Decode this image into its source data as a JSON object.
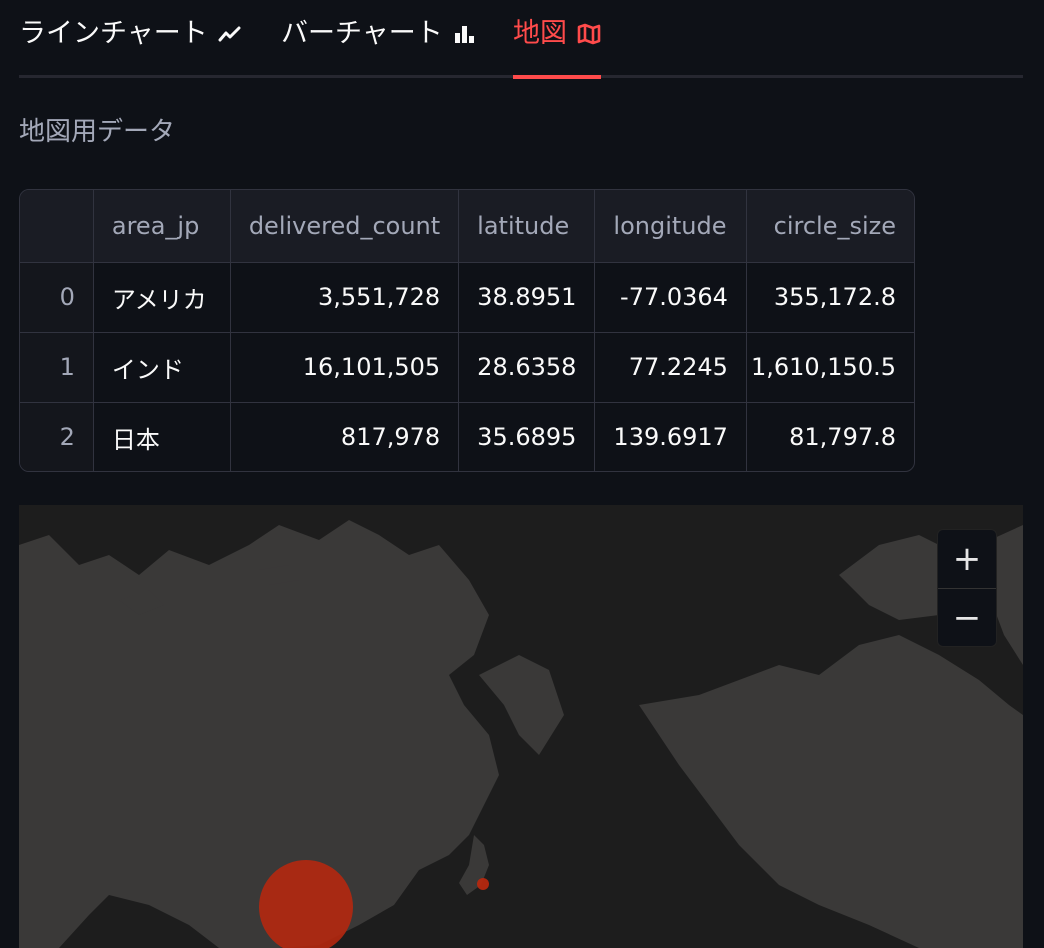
{
  "tabs": [
    {
      "label": "ラインチャート",
      "icon": "line-chart-icon",
      "active": false
    },
    {
      "label": "バーチャート",
      "icon": "bar-chart-icon",
      "active": false
    },
    {
      "label": "地図",
      "icon": "map-icon",
      "active": true
    }
  ],
  "subheading": "地図用データ",
  "table": {
    "columns": [
      "",
      "area_jp",
      "delivered_count",
      "latitude",
      "longitude",
      "circle_size"
    ],
    "rows": [
      {
        "index": "0",
        "area_jp": "アメリカ",
        "delivered_count": "3,551,728",
        "latitude": "38.8951",
        "longitude": "-77.0364",
        "circle_size": "355,172.8"
      },
      {
        "index": "1",
        "area_jp": "インド",
        "delivered_count": "16,101,505",
        "latitude": "28.6358",
        "longitude": "77.2245",
        "circle_size": "1,610,150.5"
      },
      {
        "index": "2",
        "area_jp": "日本",
        "delivered_count": "817,978",
        "latitude": "35.6895",
        "longitude": "139.6917",
        "circle_size": "81,797.8"
      }
    ]
  },
  "map": {
    "zoom_in_label": "+",
    "zoom_out_label": "−",
    "land_color": "#3a3938",
    "ocean_color": "#1d1d1d",
    "marker_color": "#b5280f"
  },
  "colors": {
    "accent": "#ff4b4b",
    "background": "#0e1117"
  }
}
